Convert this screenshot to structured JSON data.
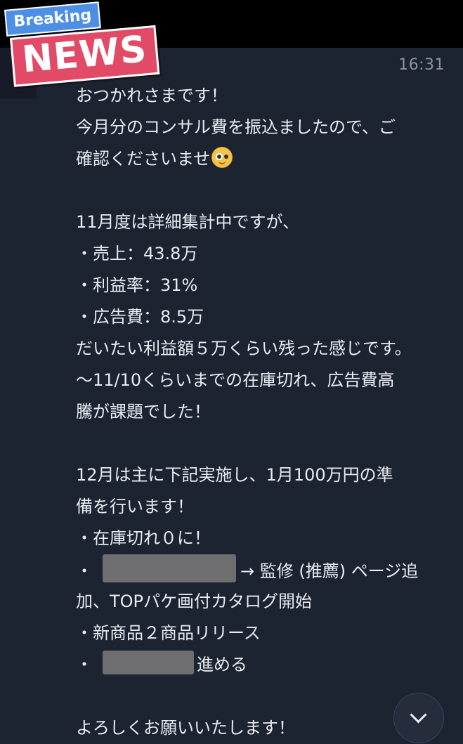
{
  "badge": {
    "breaking": "Breaking",
    "news": "NEWS"
  },
  "message": {
    "time": "16:31",
    "line1": "おつかれさまです！",
    "line2": "今月分のコンサル費を振込ましたので、ご",
    "line3": "確認くださいませ",
    "line4": "11月度は詳細集計中ですが、",
    "line5": "・売上：43.8万",
    "line6": "・利益率：31%",
    "line7": "・広告費：8.5万",
    "line8": "だいたい利益額５万くらい残った感じです。",
    "line9": "～11/10くらいまでの在庫切れ、広告費高",
    "line10": "騰が課題でした！",
    "line11": "12月は主に下記実施し、1月100万円の準",
    "line12": "備を行います！",
    "line13": "・在庫切れ０に！",
    "line14_bullet": "・",
    "line14_text": "→ 監修 (推薦) ページ追",
    "line15": "加、TOPパケ画付カタログ開始",
    "line16": "・新商品２商品リリース",
    "line17_bullet": "・",
    "line17_text": "進める",
    "line18": "よろしくお願いいたします！"
  },
  "icons": {
    "emoji": "monocle-face-emoji",
    "scroll": "chevron-down-icon"
  },
  "colors": {
    "background": "#1c2331",
    "text": "#e9ecf2",
    "timestamp": "#8d93a0",
    "breaking_badge": "#4d8fe6",
    "news_badge": "#e24b68",
    "redaction": "#6e6e70"
  }
}
